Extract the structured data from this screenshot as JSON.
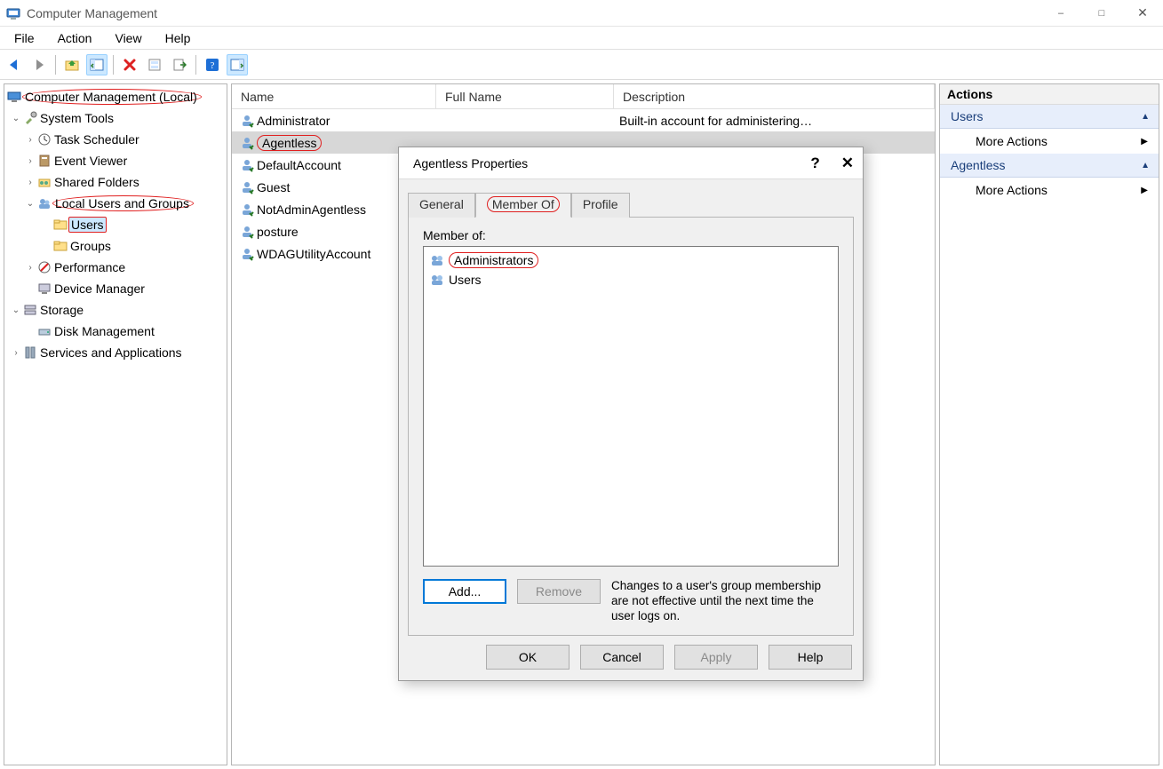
{
  "window": {
    "title": "Computer Management"
  },
  "menus": [
    "File",
    "Action",
    "View",
    "Help"
  ],
  "toolbar": [
    "back",
    "forward",
    "|",
    "up",
    "show-hide-console-tree",
    "|",
    "delete",
    "refresh",
    "export-list",
    "|",
    "help",
    "show-hide-action-pane"
  ],
  "tree": {
    "root": "Computer Management (Local)",
    "system_tools": "System Tools",
    "task_scheduler": "Task Scheduler",
    "event_viewer": "Event Viewer",
    "shared_folders": "Shared Folders",
    "local_ug": "Local Users and Groups",
    "users": "Users",
    "groups": "Groups",
    "performance": "Performance",
    "device_manager": "Device Manager",
    "storage": "Storage",
    "disk_mgmt": "Disk Management",
    "svc_apps": "Services and Applications"
  },
  "list": {
    "headers": {
      "name": "Name",
      "full": "Full Name",
      "desc": "Description"
    },
    "rows": [
      {
        "name": "Administrator",
        "full": "",
        "desc": "Built-in account for administering…"
      },
      {
        "name": "Agentless",
        "full": "",
        "desc": ""
      },
      {
        "name": "DefaultAccount",
        "full": "",
        "desc": ""
      },
      {
        "name": "Guest",
        "full": "",
        "desc": ""
      },
      {
        "name": "NotAdminAgentless",
        "full": "",
        "desc": ""
      },
      {
        "name": "posture",
        "full": "",
        "desc": ""
      },
      {
        "name": "WDAGUtilityAccount",
        "full": "",
        "desc": ""
      }
    ],
    "selected_index": 1
  },
  "actions": {
    "header": "Actions",
    "s1": "Users",
    "link": "More Actions",
    "s2": "Agentless"
  },
  "dialog": {
    "title": "Agentless Properties",
    "tabs": {
      "general": "General",
      "member_of": "Member Of",
      "profile": "Profile"
    },
    "member_label": "Member of:",
    "members": [
      "Administrators",
      "Users"
    ],
    "members_circled_index": 0,
    "buttons": {
      "add": "Add...",
      "remove": "Remove",
      "ok": "OK",
      "cancel": "Cancel",
      "apply": "Apply",
      "help": "Help"
    },
    "note": "Changes to a user's group membership are not effective until the next time the user logs on."
  }
}
